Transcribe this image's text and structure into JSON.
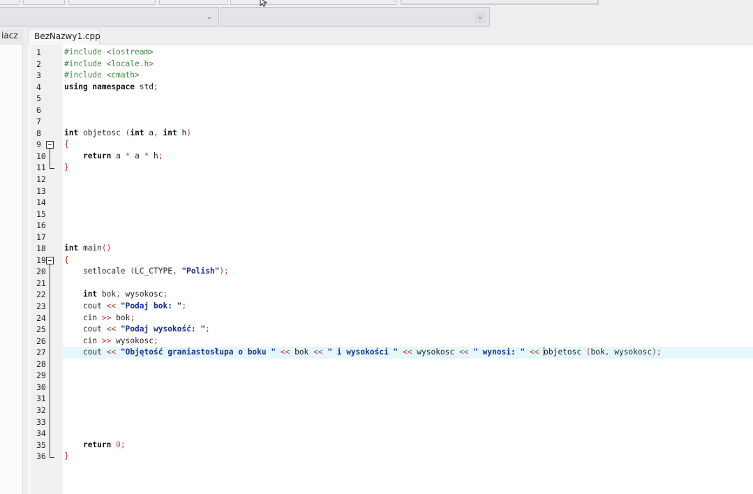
{
  "tabs": {
    "left_panel_tab": "iacz",
    "active_file": "BezNazwy1.cpp"
  },
  "combos": [
    {
      "value": "",
      "icon": "chevron-down-icon"
    },
    {
      "value": "",
      "icon": "chevron-down-icon"
    }
  ],
  "editor": {
    "highlighted_line": 27,
    "lines": [
      {
        "n": "1",
        "tokens": [
          {
            "c": "pp",
            "t": "#include <iostream>"
          }
        ]
      },
      {
        "n": "2",
        "tokens": [
          {
            "c": "pp",
            "t": "#include <locale.h>"
          }
        ]
      },
      {
        "n": "3",
        "tokens": [
          {
            "c": "pp",
            "t": "#include <cmath>"
          }
        ]
      },
      {
        "n": "4",
        "tokens": [
          {
            "c": "kw",
            "t": "using namespace "
          },
          {
            "c": "id",
            "t": "std"
          },
          {
            "c": "sym",
            "t": ";"
          }
        ]
      },
      {
        "n": "5",
        "tokens": []
      },
      {
        "n": "6",
        "tokens": []
      },
      {
        "n": "7",
        "tokens": []
      },
      {
        "n": "8",
        "tokens": [
          {
            "c": "kw",
            "t": "int "
          },
          {
            "c": "id",
            "t": "objetosc "
          },
          {
            "c": "sym",
            "t": "("
          },
          {
            "c": "kw",
            "t": "int "
          },
          {
            "c": "id",
            "t": "a"
          },
          {
            "c": "sym",
            "t": ", "
          },
          {
            "c": "kw",
            "t": "int "
          },
          {
            "c": "id",
            "t": "h"
          },
          {
            "c": "sym",
            "t": ")"
          }
        ]
      },
      {
        "n": "9",
        "tokens": [
          {
            "c": "sym",
            "t": "{"
          }
        ]
      },
      {
        "n": "10",
        "tokens": [
          {
            "c": "id",
            "t": "    "
          },
          {
            "c": "kw",
            "t": "return "
          },
          {
            "c": "id",
            "t": "a "
          },
          {
            "c": "sym",
            "t": "*"
          },
          {
            "c": "id",
            "t": " a "
          },
          {
            "c": "sym",
            "t": "*"
          },
          {
            "c": "id",
            "t": " h"
          },
          {
            "c": "sym",
            "t": ";"
          }
        ]
      },
      {
        "n": "11",
        "tokens": [
          {
            "c": "sym",
            "t": "}"
          }
        ]
      },
      {
        "n": "12",
        "tokens": []
      },
      {
        "n": "13",
        "tokens": []
      },
      {
        "n": "14",
        "tokens": []
      },
      {
        "n": "15",
        "tokens": []
      },
      {
        "n": "16",
        "tokens": []
      },
      {
        "n": "17",
        "tokens": []
      },
      {
        "n": "18",
        "tokens": [
          {
            "c": "kw",
            "t": "int "
          },
          {
            "c": "id",
            "t": "main"
          },
          {
            "c": "sym",
            "t": "()"
          }
        ]
      },
      {
        "n": "19",
        "tokens": [
          {
            "c": "sym",
            "t": "{"
          }
        ]
      },
      {
        "n": "20",
        "tokens": [
          {
            "c": "id",
            "t": "    setlocale "
          },
          {
            "c": "sym",
            "t": "("
          },
          {
            "c": "id",
            "t": "LC_CTYPE"
          },
          {
            "c": "sym",
            "t": ", "
          },
          {
            "c": "str",
            "t": "\"Polish\""
          },
          {
            "c": "sym",
            "t": ");"
          }
        ]
      },
      {
        "n": "21",
        "tokens": []
      },
      {
        "n": "22",
        "tokens": [
          {
            "c": "id",
            "t": "    "
          },
          {
            "c": "kw",
            "t": "int "
          },
          {
            "c": "id",
            "t": "bok"
          },
          {
            "c": "sym",
            "t": ", "
          },
          {
            "c": "id",
            "t": "wysokosc"
          },
          {
            "c": "sym",
            "t": ";"
          }
        ]
      },
      {
        "n": "23",
        "tokens": [
          {
            "c": "id",
            "t": "    cout "
          },
          {
            "c": "sym",
            "t": "<< "
          },
          {
            "c": "str",
            "t": "\"Podaj bok: \""
          },
          {
            "c": "sym",
            "t": ";"
          }
        ]
      },
      {
        "n": "24",
        "tokens": [
          {
            "c": "id",
            "t": "    cin "
          },
          {
            "c": "sym",
            "t": ">> "
          },
          {
            "c": "id",
            "t": "bok"
          },
          {
            "c": "sym",
            "t": ";"
          }
        ]
      },
      {
        "n": "25",
        "tokens": [
          {
            "c": "id",
            "t": "    cout "
          },
          {
            "c": "sym",
            "t": "<< "
          },
          {
            "c": "str",
            "t": "\"Podaj wysokość: \""
          },
          {
            "c": "sym",
            "t": ";"
          }
        ]
      },
      {
        "n": "26",
        "tokens": [
          {
            "c": "id",
            "t": "    cin "
          },
          {
            "c": "sym",
            "t": ">> "
          },
          {
            "c": "id",
            "t": "wysokosc"
          },
          {
            "c": "sym",
            "t": ";"
          }
        ]
      },
      {
        "n": "27",
        "tokens": [
          {
            "c": "id",
            "t": "    cout "
          },
          {
            "c": "sym",
            "t": "<< "
          },
          {
            "c": "str",
            "t": "\"Objętość graniastosłupa o boku \""
          },
          {
            "c": "sym",
            "t": " << "
          },
          {
            "c": "id",
            "t": "bok "
          },
          {
            "c": "sym",
            "t": "<< "
          },
          {
            "c": "str",
            "t": "\" i wysokości \""
          },
          {
            "c": "sym",
            "t": " << "
          },
          {
            "c": "id",
            "t": "wysokosc "
          },
          {
            "c": "sym",
            "t": "<< "
          },
          {
            "c": "str",
            "t": "\" wynosi: \""
          },
          {
            "c": "sym",
            "t": " << "
          },
          {
            "c": "caret",
            "t": ""
          },
          {
            "c": "id",
            "t": "objetosc "
          },
          {
            "c": "sym",
            "t": "("
          },
          {
            "c": "id",
            "t": "bok"
          },
          {
            "c": "sym",
            "t": ", "
          },
          {
            "c": "id",
            "t": "wysokosc"
          },
          {
            "c": "sym",
            "t": ");"
          }
        ]
      },
      {
        "n": "28",
        "tokens": []
      },
      {
        "n": "29",
        "tokens": []
      },
      {
        "n": "30",
        "tokens": []
      },
      {
        "n": "31",
        "tokens": []
      },
      {
        "n": "32",
        "tokens": []
      },
      {
        "n": "33",
        "tokens": []
      },
      {
        "n": "34",
        "tokens": []
      },
      {
        "n": "35",
        "tokens": [
          {
            "c": "id",
            "t": "    "
          },
          {
            "c": "kw",
            "t": "return "
          },
          {
            "c": "num",
            "t": "0"
          },
          {
            "c": "sym",
            "t": ";"
          }
        ]
      },
      {
        "n": "36",
        "tokens": [
          {
            "c": "sym",
            "t": "}"
          }
        ]
      }
    ],
    "folds": [
      {
        "start": 9,
        "end": 11,
        "icon": "fold-collapse-icon"
      },
      {
        "start": 19,
        "end": 36,
        "icon": "fold-collapse-icon"
      }
    ]
  }
}
